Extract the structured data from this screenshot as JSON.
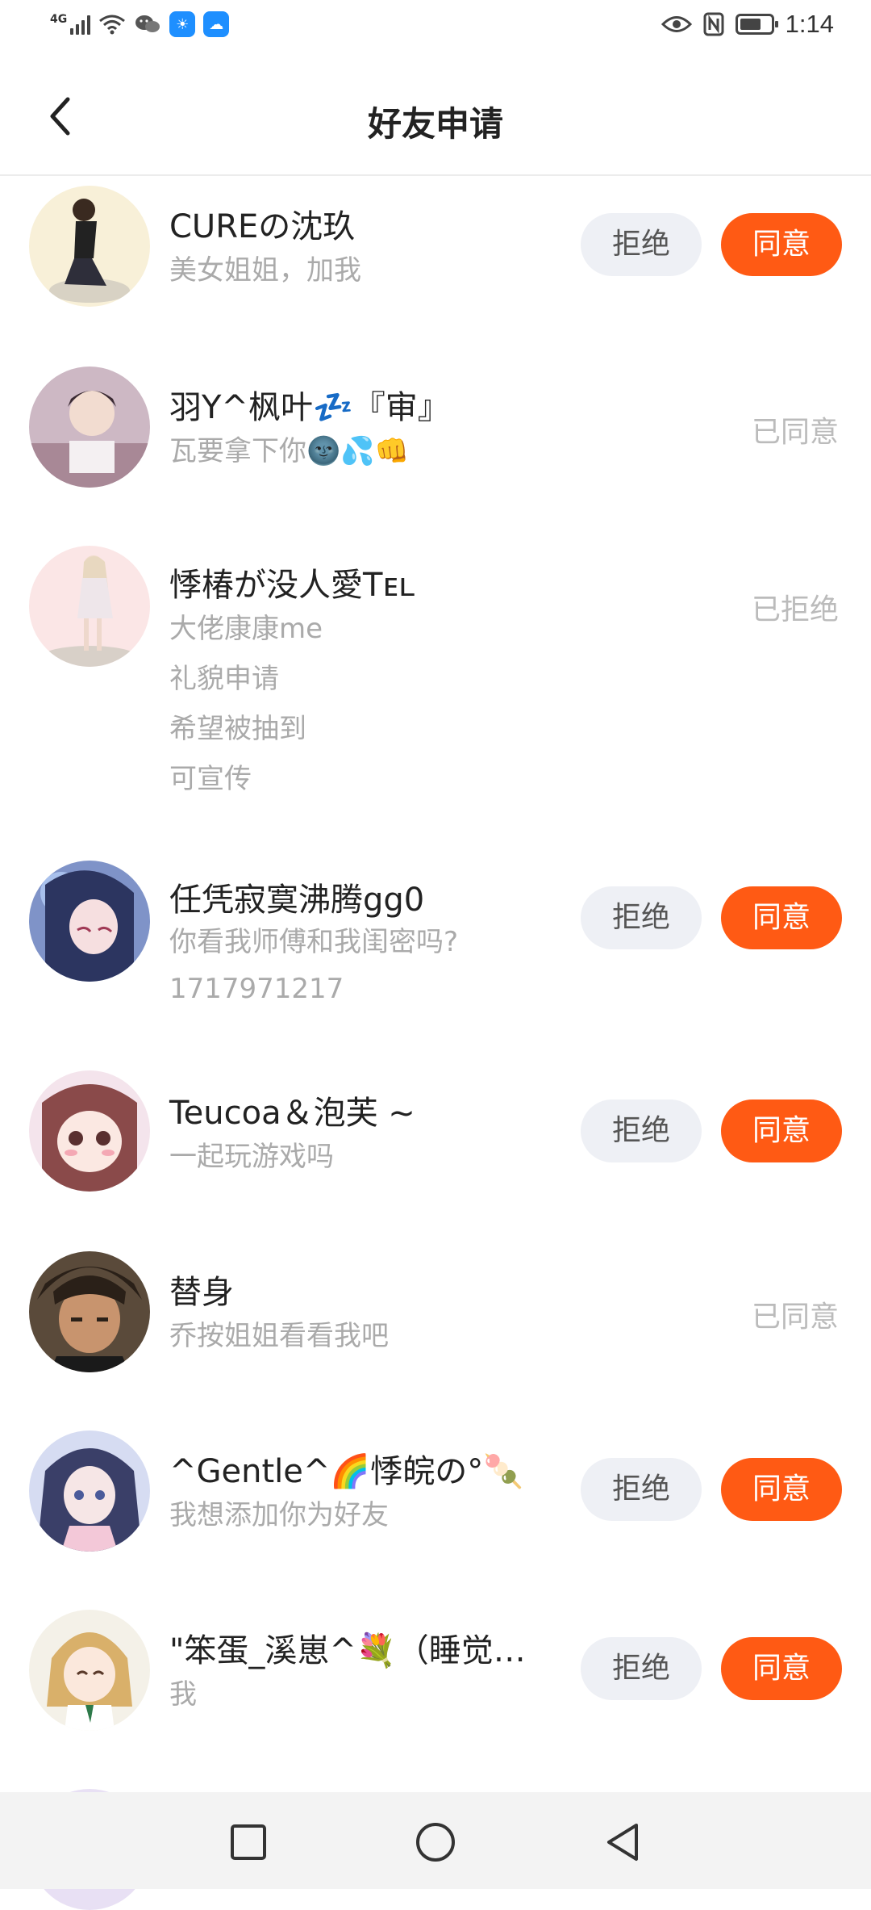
{
  "status_bar": {
    "network": "4G",
    "time": "1:14"
  },
  "header": {
    "title": "好友申请"
  },
  "buttons": {
    "reject": "拒绝",
    "accept": "同意"
  },
  "requests": [
    {
      "name": "CUREの沈玖",
      "messages": [
        "美女姐姐，加我"
      ],
      "state": "pending"
    },
    {
      "name": "羽Y^枫叶💤『审』",
      "messages": [
        "瓦要拿下你🌚💦👊"
      ],
      "state": "accepted",
      "status_text": "已同意"
    },
    {
      "name": "悸椿が没人愛Tᴇʟ",
      "messages": [
        "大佬康康me",
        "礼貌申请",
        "希望被抽到",
        "可宣传"
      ],
      "state": "rejected",
      "status_text": "已拒绝"
    },
    {
      "name": "任凭寂寞沸腾gg0",
      "messages": [
        "你看我师傅和我闺密吗?",
        "1717971217"
      ],
      "state": "pending"
    },
    {
      "name": "Teucoa＆泡芙 ~",
      "messages": [
        "一起玩游戏吗"
      ],
      "state": "pending"
    },
    {
      "name": "替身",
      "messages": [
        "乔按姐姐看看我吧"
      ],
      "state": "accepted",
      "status_text": "已同意"
    },
    {
      "name": "^Gentle^🌈悸皖の°🍡",
      "messages": [
        "我想添加你为好友"
      ],
      "state": "pending"
    },
    {
      "name": "\"笨蛋_溪崽^💐（睡觉…",
      "messages": [
        "我"
      ],
      "state": "pending"
    }
  ],
  "icons": {
    "back": "chevron-left-icon",
    "nav": [
      "recent-apps-icon",
      "home-icon",
      "back-triangle-icon"
    ]
  }
}
